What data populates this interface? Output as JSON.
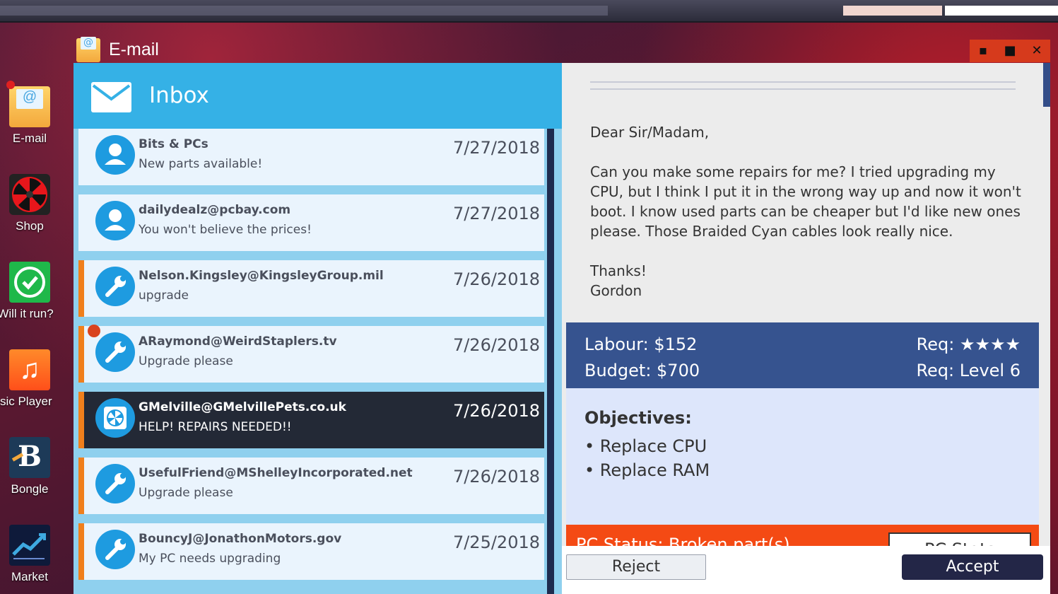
{
  "desktop": {
    "icons": [
      {
        "label": "E-mail"
      },
      {
        "label": "Shop"
      },
      {
        "label": "Will it run?"
      },
      {
        "label": "Music Player"
      },
      {
        "label": "Bongle"
      },
      {
        "label": "Market"
      }
    ]
  },
  "window": {
    "title": "E-mail",
    "controls": {
      "minimize": "▪",
      "maximize": "■",
      "close": "✕"
    }
  },
  "inbox": {
    "title": "Inbox",
    "emails": [
      {
        "from": "Bits & PCs",
        "subject": "New parts available!",
        "date": "7/27/2018",
        "icon": "person-icon"
      },
      {
        "from": "dailydealz@pcbay.com",
        "subject": "You won't believe the prices!",
        "date": "7/27/2018",
        "icon": "person-icon"
      },
      {
        "from": "Nelson.Kingsley@KingsleyGroup.mil",
        "subject": "upgrade",
        "date": "7/26/2018",
        "icon": "wrench-icon"
      },
      {
        "from": "ARaymond@WeirdStaplers.tv",
        "subject": "Upgrade please",
        "date": "7/26/2018",
        "icon": "wrench-icon"
      },
      {
        "from": "GMelville@GMelvillePets.co.uk",
        "subject": "HELP! REPAIRS NEEDED!!",
        "date": "7/26/2018",
        "icon": "fan-icon"
      },
      {
        "from": "UsefulFriend@MShelleyIncorporated.net",
        "subject": "Upgrade please",
        "date": "7/26/2018",
        "icon": "wrench-icon"
      },
      {
        "from": "BouncyJ@JonathonMotors.gov",
        "subject": "My PC needs upgrading",
        "date": "7/25/2018",
        "icon": "wrench-icon"
      }
    ]
  },
  "message": {
    "greeting": "Dear Sir/Madam,",
    "body": "Can you make some repairs for me? I tried upgrading my CPU, but I think I put it in the wrong way up and now it won't boot. I know used parts can be cheaper but I'd like new ones please. Those Braided Cyan cables look really nice.",
    "signoff": "Thanks!",
    "signature": "Gordon"
  },
  "job": {
    "labour": "Labour: $152",
    "budget": "Budget: $700",
    "req_stars": "Req: ★★★★",
    "req_level": "Req: Level 6",
    "objectives_title": "Objectives:",
    "objectives": [
      "• Replace CPU",
      "• Replace RAM"
    ],
    "status_text": "PC Status: Broken part(s)",
    "stats_button": "PC Stats"
  },
  "actions": {
    "reject": "Reject",
    "accept": "Accept"
  },
  "colors": {
    "accent": "#35b1e6",
    "selected": "#232936",
    "status": "#f44a14",
    "pay_panel": "#36538f",
    "accept": "#232647"
  }
}
